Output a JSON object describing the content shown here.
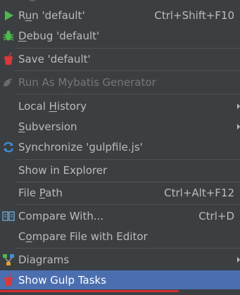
{
  "menu": {
    "items": [
      {
        "id": "run",
        "label_pre": "R",
        "label_u": "u",
        "label_post": "n 'default'",
        "shortcut": "Ctrl+Shift+F10",
        "icon": "run-triangle-icon"
      },
      {
        "id": "debug",
        "label_pre": "",
        "label_u": "D",
        "label_post": "ebug 'default'",
        "shortcut": "",
        "icon": "debug-bug-icon"
      },
      {
        "id": "save",
        "label": "Save 'default'",
        "icon": "gulp-cup-icon"
      },
      {
        "id": "mybatis",
        "label": "Run As Mybatis Generator",
        "icon": "mybatis-bird-icon",
        "disabled": true
      },
      {
        "id": "local-history",
        "label_pre": "Local ",
        "label_u": "H",
        "label_post": "istory",
        "submenu": true
      },
      {
        "id": "subversion",
        "label_pre": "",
        "label_u": "S",
        "label_post": "ubversion",
        "submenu": true
      },
      {
        "id": "synchronize",
        "label": "Synchronize 'gulpfile.js'",
        "icon": "sync-icon"
      },
      {
        "id": "show-in-explorer",
        "label": "Show in Explorer"
      },
      {
        "id": "file-path",
        "label_pre": "File ",
        "label_u": "P",
        "label_post": "ath",
        "shortcut": "Ctrl+Alt+F12"
      },
      {
        "id": "compare-with",
        "label": "Compare With...",
        "shortcut": "Ctrl+D",
        "icon": "compare-icon"
      },
      {
        "id": "compare-editor",
        "label_pre": "C",
        "label_u": "o",
        "label_post": "mpare File with Editor"
      },
      {
        "id": "diagrams",
        "label": "Diagrams",
        "icon": "diagram-icon",
        "submenu": true
      },
      {
        "id": "show-gulp-tasks",
        "label": "Show Gulp Tasks",
        "icon": "gulp-cup-icon",
        "selected": true
      }
    ]
  },
  "colors": {
    "background": "#3c3f41",
    "text": "#bbbbbb",
    "disabled_text": "#777777",
    "selection": "#4b6eaf",
    "run_green": "#4fb94f",
    "gulp_red": "#d9383a",
    "sync_blue": "#3d8fd8",
    "annotation_red": "#d23030"
  }
}
